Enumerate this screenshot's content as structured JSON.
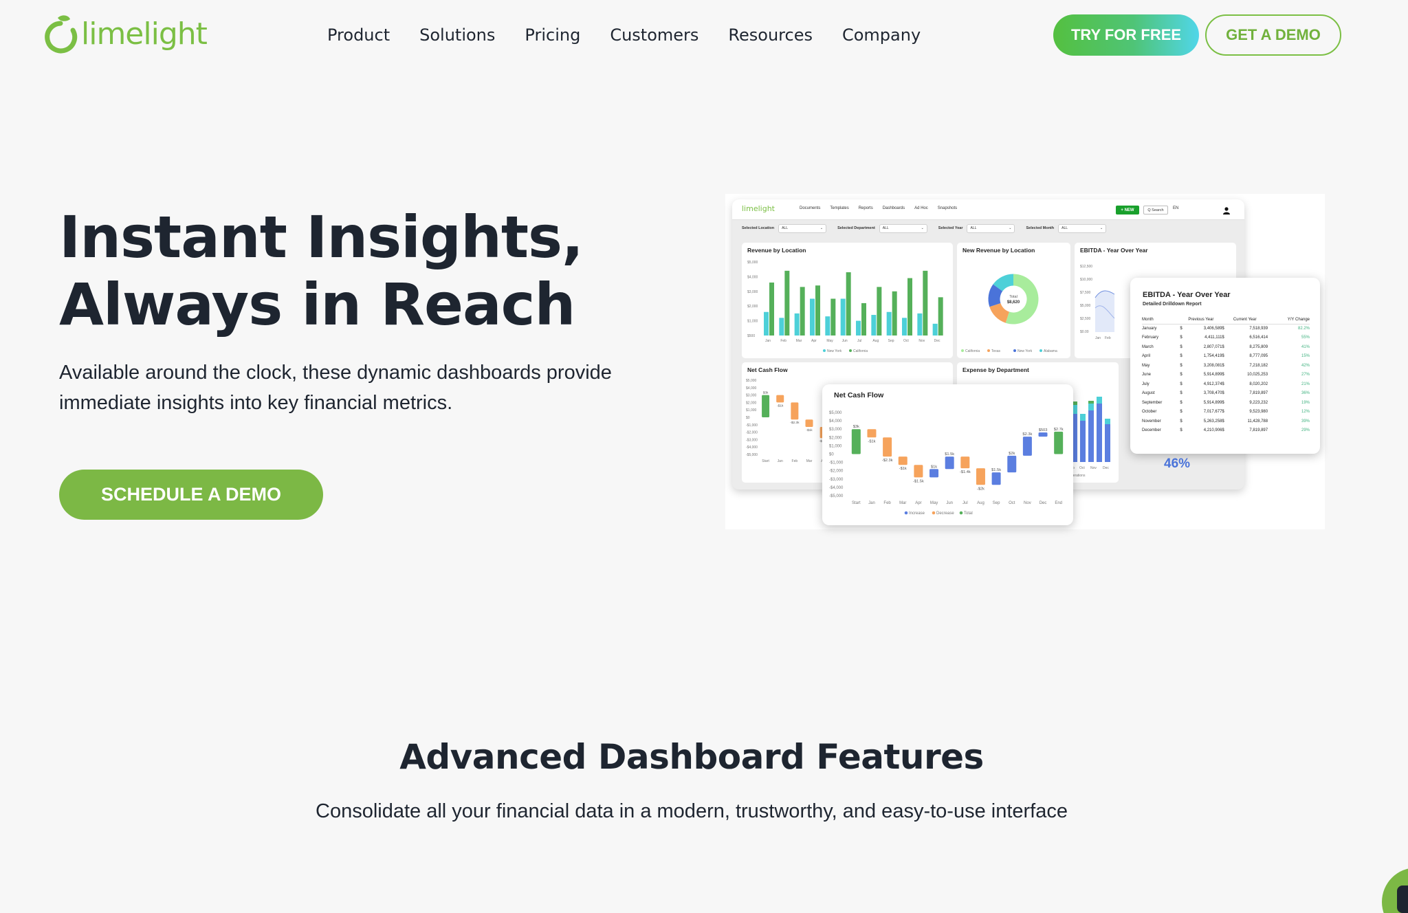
{
  "brand": {
    "name": "limelight",
    "color": "#7bbf44"
  },
  "nav": {
    "items": [
      {
        "label": "Product"
      },
      {
        "label": "Solutions"
      },
      {
        "label": "Pricing"
      },
      {
        "label": "Customers"
      },
      {
        "label": "Resources"
      },
      {
        "label": "Company"
      }
    ],
    "try_label": "TRY FOR FREE",
    "demo_label": "GET A DEMO"
  },
  "hero": {
    "title_line1": "Instant Insights,",
    "title_line2": "Always in Reach",
    "subtitle": "Available around the clock, these dynamic dashboards provide immediate insights into key financial metrics.",
    "cta_label": "SCHEDULE A DEMO"
  },
  "dashboard": {
    "logo": "limelight",
    "nav": [
      "Documents",
      "Templates",
      "Reports",
      "Dashboards",
      "Ad Hoc",
      "Snapshots"
    ],
    "new_label": "+ NEW",
    "search_label": "Q Search",
    "lang_label": "EN",
    "filters": [
      {
        "label": "Selected Location",
        "value": "ALL"
      },
      {
        "label": "Selected Department",
        "value": "ALL"
      },
      {
        "label": "Selected Year",
        "value": "ALL"
      },
      {
        "label": "Selected Month",
        "value": "ALL"
      }
    ],
    "cards": {
      "revenue": "Revenue by Location",
      "new_revenue": "New Revenue by Location",
      "ebitda_small": "EBITDA - Year Over Year",
      "net_cash_small": "Net Cash Flow",
      "expense": "Expense by Department",
      "net_cash": "Net Cash Flow"
    },
    "percent_label": "46%",
    "donut_total_label": "Total",
    "donut_total_value": "$8,620",
    "ebitda_detail": {
      "title": "EBITDA - Year Over Year",
      "subtitle": "Detailed Drilldown Report",
      "headers": [
        "Month",
        "Previous Year",
        "Current Year",
        "Y/Y Change"
      ],
      "rows": [
        {
          "month": "January",
          "prev": "3,406,589",
          "curr": "7,518,939",
          "chg": "82.2%"
        },
        {
          "month": "February",
          "prev": "4,411,111",
          "curr": "6,516,414",
          "chg": "55%"
        },
        {
          "month": "March",
          "prev": "2,807,071",
          "curr": "8,275,809",
          "chg": "41%"
        },
        {
          "month": "April",
          "prev": "1,754,419",
          "curr": "8,777,095",
          "chg": "15%"
        },
        {
          "month": "May",
          "prev": "3,208,081",
          "curr": "7,218,182",
          "chg": "42%"
        },
        {
          "month": "June",
          "prev": "5,914,899",
          "curr": "10,025,253",
          "chg": "27%"
        },
        {
          "month": "July",
          "prev": "4,912,374",
          "curr": "8,020,202",
          "chg": "21%"
        },
        {
          "month": "August",
          "prev": "3,708,470",
          "curr": "7,819,897",
          "chg": "36%"
        },
        {
          "month": "September",
          "prev": "5,914,899",
          "curr": "9,223,232",
          "chg": "19%"
        },
        {
          "month": "October",
          "prev": "7,017,677",
          "curr": "9,523,980",
          "chg": "12%"
        },
        {
          "month": "November",
          "prev": "5,263,258",
          "curr": "11,428,788",
          "chg": "39%"
        },
        {
          "month": "December",
          "prev": "4,210,906",
          "curr": "7,819,897",
          "chg": "29%"
        }
      ]
    }
  },
  "chart_data": [
    {
      "type": "bar",
      "title": "Revenue by Location",
      "categories": [
        "Jan",
        "Feb",
        "Mar",
        "Apr",
        "May",
        "Jun",
        "Jul",
        "Aug",
        "Sep",
        "Oct",
        "Nov",
        "Dec"
      ],
      "ylim": [
        0,
        5000
      ],
      "yticks": [
        "$5,000",
        "$4,000",
        "$3,000",
        "$2,000",
        "$1,000",
        "$500"
      ],
      "series": [
        {
          "name": "New York",
          "color": "#4dd0d8",
          "values": [
            1600,
            1200,
            1500,
            2500,
            1300,
            2500,
            1000,
            1400,
            1600,
            1200,
            1500,
            800
          ]
        },
        {
          "name": "California",
          "color": "#55b05a",
          "values": [
            3600,
            4400,
            3300,
            3400,
            2500,
            4300,
            2200,
            3300,
            3000,
            3900,
            4400,
            2600
          ]
        }
      ]
    },
    {
      "type": "pie",
      "title": "New Revenue by Location",
      "series": [
        {
          "name": "California",
          "color": "#a8ec9c",
          "value": 55
        },
        {
          "name": "Texas",
          "color": "#f6a35c",
          "value": 15
        },
        {
          "name": "New York",
          "color": "#4a73d9",
          "value": 15
        },
        {
          "name": "Alabama",
          "color": "#4dd0d8",
          "value": 15
        }
      ]
    },
    {
      "type": "bar",
      "title": "Net Cash Flow",
      "categories": [
        "Start",
        "Jan",
        "Feb",
        "Mar",
        "Apr",
        "May",
        "Jun",
        "Jul",
        "Aug",
        "Sep",
        "Oct",
        "Nov",
        "Dec",
        "End"
      ],
      "ylim": [
        -5000,
        5000
      ],
      "yticks": [
        "$5,000",
        "$4,000",
        "$3,000",
        "$2,000",
        "$1,000",
        "$0",
        "-$1,000",
        "-$2,000",
        "-$3,000",
        "-$4,000",
        "-$5,000"
      ],
      "series": [
        {
          "name": "Increase",
          "color": "#5b7ee0"
        },
        {
          "name": "Decrease",
          "color": "#f6a35c"
        },
        {
          "name": "Total",
          "color": "#55b05a"
        }
      ],
      "bars": [
        {
          "label": "Start",
          "from": 0,
          "to": 3000,
          "kind": "Total",
          "text": "$3k"
        },
        {
          "label": "Jan",
          "from": 3000,
          "to": 2000,
          "kind": "Decrease",
          "text": "-$1k"
        },
        {
          "label": "Feb",
          "from": 2000,
          "to": -300,
          "kind": "Decrease",
          "text": "-$2.3k"
        },
        {
          "label": "Mar",
          "from": -300,
          "to": -1300,
          "kind": "Decrease",
          "text": "-$1k"
        },
        {
          "label": "Apr",
          "from": -1300,
          "to": -2800,
          "kind": "Decrease",
          "text": "-$1.5k"
        },
        {
          "label": "May",
          "from": -2800,
          "to": -1800,
          "kind": "Increase",
          "text": "$1k"
        },
        {
          "label": "Jun",
          "from": -1800,
          "to": -300,
          "kind": "Increase",
          "text": "$1.5k"
        },
        {
          "label": "Jul",
          "from": -300,
          "to": -1700,
          "kind": "Decrease",
          "text": "-$1.4k"
        },
        {
          "label": "Aug",
          "from": -1700,
          "to": -3700,
          "kind": "Decrease",
          "text": "-$2k"
        },
        {
          "label": "Sep",
          "from": -3700,
          "to": -2200,
          "kind": "Increase",
          "text": "$1.5k"
        },
        {
          "label": "Oct",
          "from": -2200,
          "to": -200,
          "kind": "Increase",
          "text": "$2k"
        },
        {
          "label": "Nov",
          "from": -200,
          "to": 2100,
          "kind": "Increase",
          "text": "$2.3k"
        },
        {
          "label": "Dec",
          "from": 2100,
          "to": 2600,
          "kind": "Increase",
          "text": "$503"
        },
        {
          "label": "End",
          "from": 0,
          "to": 2700,
          "kind": "Total",
          "text": "$2.7k"
        }
      ]
    }
  ],
  "features": {
    "title": "Advanced Dashboard Features",
    "subtitle": "Consolidate all your financial data in a modern, trustworthy, and easy-to-use interface"
  }
}
